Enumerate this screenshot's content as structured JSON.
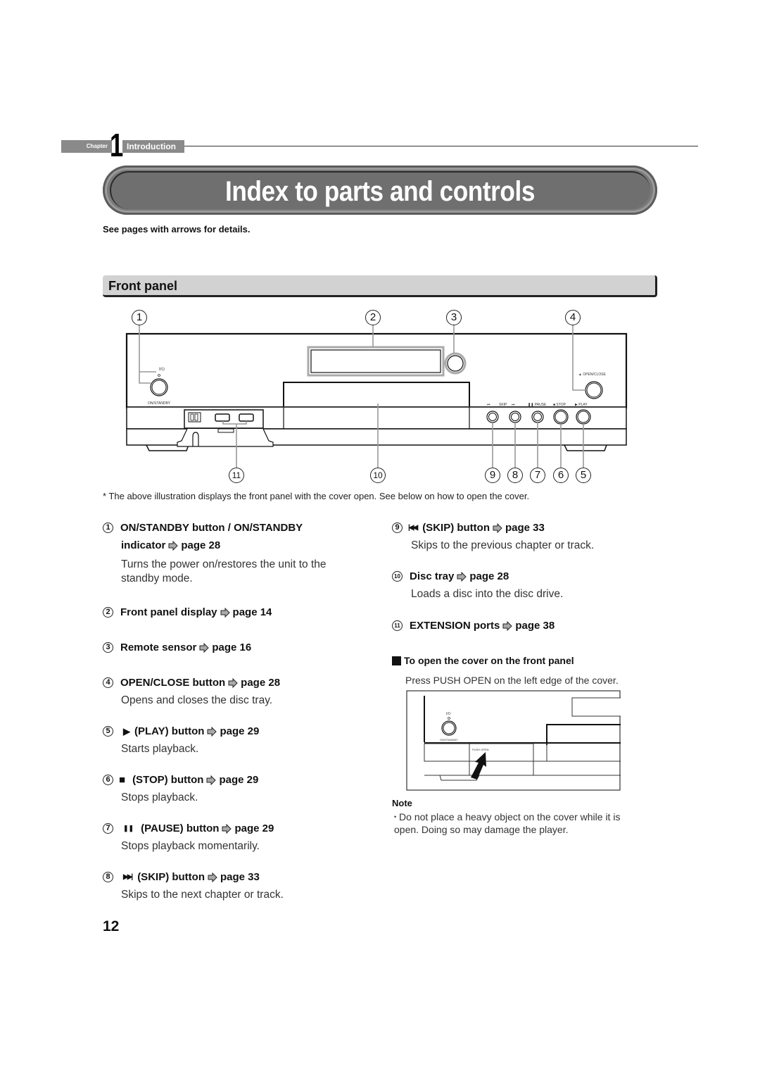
{
  "header": {
    "chapter_label": "Chapter",
    "chapter_number": "1",
    "chapter_title": "Introduction",
    "page_title": "Index to parts and controls",
    "subtitle": "See pages with arrows for details."
  },
  "section": {
    "title": "Front panel"
  },
  "diagram": {
    "top_callouts": [
      "1",
      "2",
      "3",
      "4"
    ],
    "bottom_callouts": [
      "11",
      "10",
      "9",
      "8",
      "7",
      "6",
      "5"
    ],
    "panel_labels": {
      "power_symbol": "I/⏻",
      "on_standby": "ON/STANDBY",
      "open_close": "▲ OPEN/CLOSE",
      "skip_prev": "⏮",
      "skip": "SKIP",
      "skip_next": "⏭",
      "pause": "❚❚ PAUSE",
      "stop": "■ STOP",
      "play": "▶ PLAY"
    }
  },
  "footnote": "* The above illustration displays the front panel with the cover open. See below on how to open the cover.",
  "left_entries": [
    {
      "num": "1",
      "glyph": "",
      "head": "ON/STANDBY button / ON/STANDBY",
      "head2": "indicator",
      "page": "page 28",
      "desc": "Turns the power on/restores the unit to the standby mode."
    },
    {
      "num": "2",
      "glyph": "",
      "head": "Front panel display",
      "page": "page 14",
      "desc": ""
    },
    {
      "num": "3",
      "glyph": "",
      "head": "Remote sensor",
      "page": "page 16",
      "desc": ""
    },
    {
      "num": "4",
      "glyph": "",
      "head": "OPEN/CLOSE button",
      "page": "page 28",
      "desc": "Opens and closes the disc tray."
    },
    {
      "num": "5",
      "glyph": "▶",
      "head": "(PLAY) button",
      "page": "page 29",
      "desc": "Starts playback."
    },
    {
      "num": "6",
      "glyph": "■",
      "head": "(STOP) button",
      "page": "page 29",
      "desc": "Stops playback."
    },
    {
      "num": "7",
      "glyph": "❚❚",
      "head": "(PAUSE) button",
      "page": "page 29",
      "desc": "Stops playback momentarily."
    },
    {
      "num": "8",
      "glyph": "▶▶|",
      "head": "(SKIP) button",
      "page": "page 33",
      "desc": "Skips to the next chapter or track."
    }
  ],
  "right_entries": [
    {
      "num": "9",
      "glyph": "|◀◀",
      "head": "(SKIP) button",
      "page": "page 33",
      "desc": "Skips to the previous chapter or track."
    },
    {
      "num": "10",
      "glyph": "",
      "head": "Disc tray",
      "page": "page 28",
      "desc": "Loads a disc into the disc drive."
    },
    {
      "num": "11",
      "glyph": "",
      "head": "EXTENSION ports",
      "page": "page 38",
      "desc": ""
    }
  ],
  "cover_section": {
    "title": "To open the cover on the front panel",
    "desc": "Press PUSH OPEN on the left edge of the cover.",
    "illustration_labels": {
      "power_symbol": "I/⏻",
      "on_standby": "ON/STANDBY",
      "push_open": "PUSH OPEN"
    }
  },
  "note": {
    "title": "Note",
    "text": "Do not place a heavy object on the cover while it is open. Doing so may damage the player."
  },
  "page_number": "12"
}
